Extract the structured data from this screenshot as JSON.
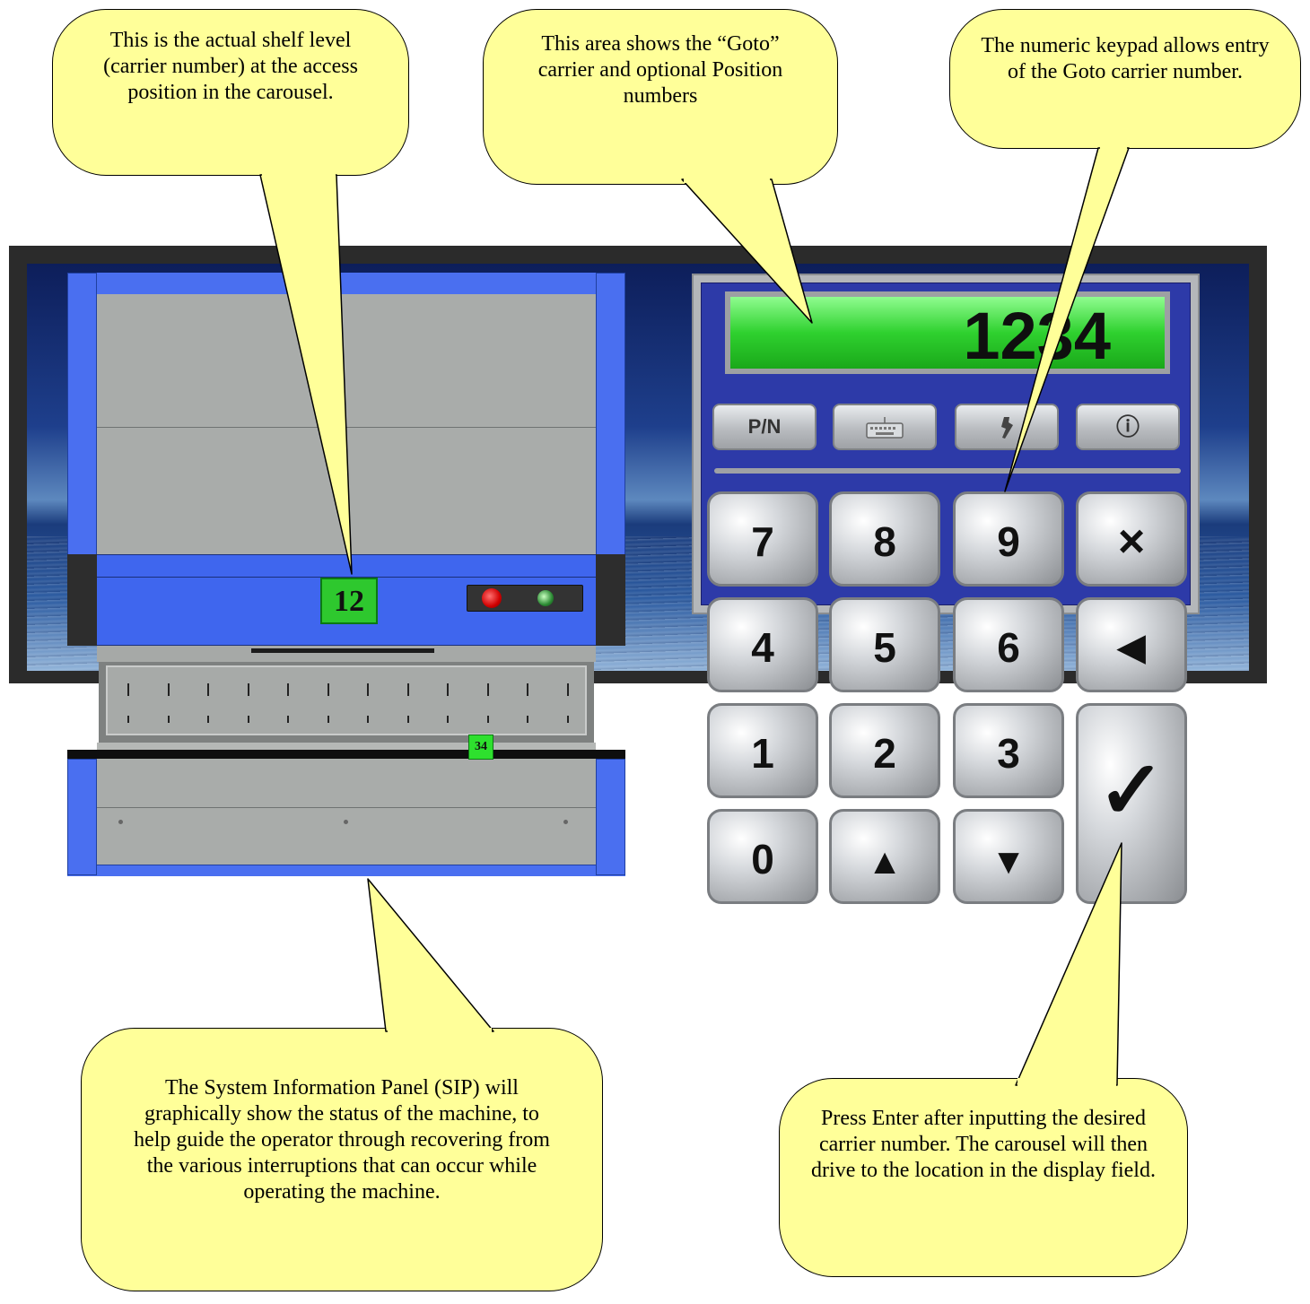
{
  "callouts": {
    "shelf_level": "This is the actual shelf level (carrier number) at the access position in the carousel.",
    "goto_area": "This area shows the “Goto” carrier and optional Position numbers",
    "keypad": "The numeric keypad allows entry of the Goto carrier number.",
    "sip": "The System Information Panel (SIP) will graphically show the status of the machine, to help guide the operator through recovering from the various interruptions that can occur while operating the machine.",
    "enter": "Press Enter after inputting the desired carrier number. The carousel will then drive to the location in the display field."
  },
  "sip": {
    "carrier_number": "12",
    "position_number": "34",
    "lights": {
      "stop": "#e00000",
      "ready": "#2c8a34"
    }
  },
  "keypad": {
    "display_value": "1234",
    "function_buttons": {
      "pn_label": "P/N",
      "keyboard_icon": "keyboard-icon",
      "settings_icon": "settings-icon",
      "info_icon": "info-icon",
      "info_glyph": "ⓘ"
    },
    "keys": {
      "k7": "7",
      "k8": "8",
      "k9": "9",
      "clear": "×",
      "k4": "4",
      "k5": "5",
      "k6": "6",
      "backspace": "◀",
      "k1": "1",
      "k2": "2",
      "k3": "3",
      "enter": "✓",
      "k0": "0",
      "up": "▲",
      "down": "▼"
    }
  },
  "colors": {
    "callout_fill": "#ffff99",
    "display_green": "#2fd12f",
    "keypad_blue": "#2d3aa8",
    "sip_blue": "#4a6ff0"
  }
}
